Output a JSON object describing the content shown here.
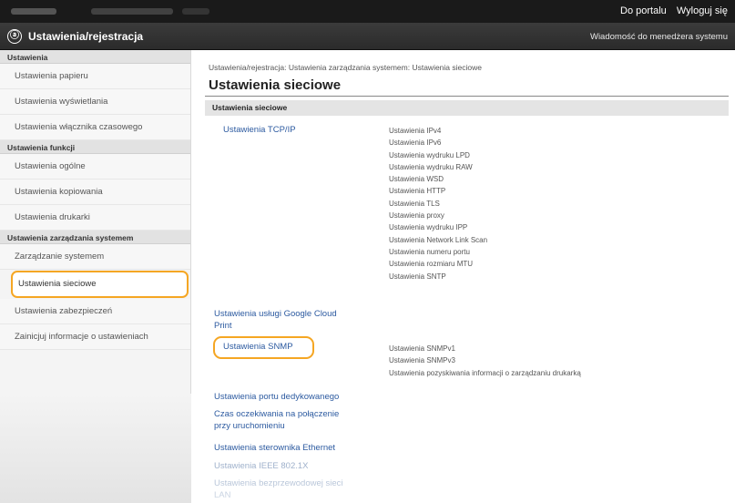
{
  "topbar": {
    "portal_link": "Do portalu",
    "logout_link": "Wyloguj się"
  },
  "titlebar": {
    "logo_glyph": "ⓐ",
    "title": "Ustawienia/rejestracja",
    "message_link": "Wiadomość do menedżera systemu"
  },
  "sidebar": {
    "sections": [
      {
        "header": "Ustawienia",
        "items": [
          "Ustawienia papieru",
          "Ustawienia wyświetlania",
          "Ustawienia włącznika czasowego"
        ]
      },
      {
        "header": "Ustawienia funkcji",
        "items": [
          "Ustawienia ogólne",
          "Ustawienia kopiowania",
          "Ustawienia drukarki"
        ]
      },
      {
        "header": "Ustawienia zarządzania systemem",
        "items": [
          "Zarządzanie systemem",
          "Ustawienia sieciowe",
          "Ustawienia zabezpieczeń",
          "Zainicjuj informacje o ustawieniach"
        ]
      }
    ],
    "active_item": "Ustawienia sieciowe"
  },
  "main": {
    "breadcrumb": "Ustawienia/rejestracja: Ustawienia zarządzania systemem: Ustawienia sieciowe",
    "title": "Ustawienia sieciowe",
    "section_header": "Ustawienia sieciowe",
    "tcpip": {
      "label": "Ustawienia TCP/IP",
      "subitems": [
        "Ustawienia IPv4",
        "Ustawienia IPv6",
        "Ustawienia wydruku LPD",
        "Ustawienia wydruku RAW",
        "Ustawienia WSD",
        "Ustawienia HTTP",
        "Ustawienia TLS",
        "Ustawienia proxy",
        "Ustawienia wydruku IPP",
        "Ustawienia Network Link Scan",
        "Ustawienia numeru portu",
        "Ustawienia rozmiaru MTU",
        "Ustawienia SNTP"
      ]
    },
    "google_cloud": {
      "label_line1": "Ustawienia usługi Google Cloud",
      "label_line2": "Print"
    },
    "snmp": {
      "label": "Ustawienia SNMP",
      "subitems": [
        "Ustawienia SNMPv1",
        "Ustawienia SNMPv3",
        "Ustawienia pozyskiwania informacji o zarządzaniu drukarką"
      ]
    },
    "links": {
      "dedicated_port": "Ustawienia portu dedykowanego",
      "wait_line1": "Czas oczekiwania na połączenie",
      "wait_line2": "przy uruchomieniu",
      "ethernet": "Ustawienia sterownika Ethernet",
      "ieee": "Ustawienia IEEE 802.1X",
      "wlan_line1": "Ustawienia bezprzewodowej sieci",
      "wlan_line2": "LAN"
    }
  },
  "colors": {
    "highlight": "#f5a623",
    "link": "#2c5aa0",
    "header_bg": "#1a1a1a"
  }
}
